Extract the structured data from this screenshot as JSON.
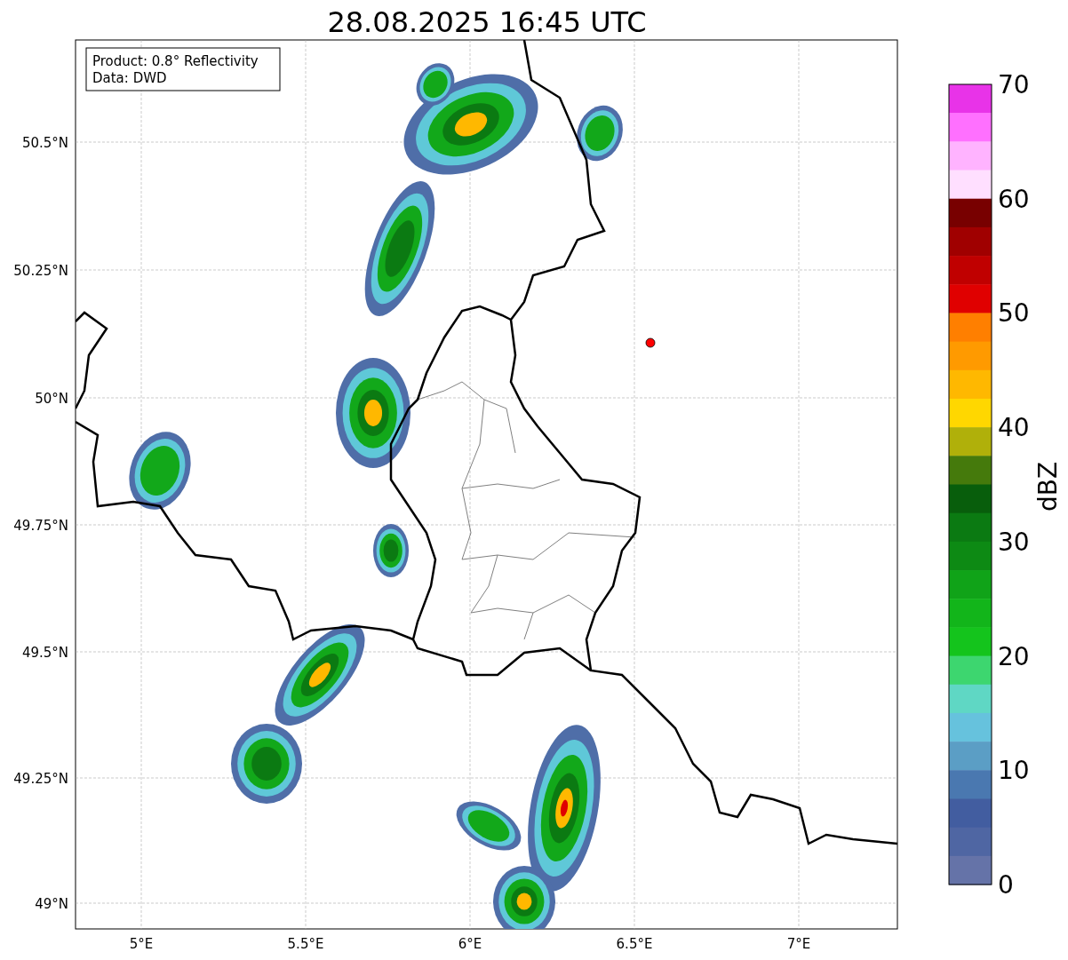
{
  "title": "28.08.2025 16:45 UTC",
  "info_box": [
    "Product: 0.8° Reflectivity",
    "Data: DWD"
  ],
  "y_ticks": [
    "50.5°N",
    "50.25°N",
    "50°N",
    "49.75°N",
    "49.5°N",
    "49.25°N",
    "49°N"
  ],
  "x_ticks": [
    "5°E",
    "5.5°E",
    "6°E",
    "6.5°E",
    "7°E"
  ],
  "colorbar": {
    "label": "dBZ",
    "ticks": [
      "70",
      "60",
      "50",
      "40",
      "30",
      "20",
      "10",
      "0"
    ],
    "bands": [
      {
        "color": "#e833e8"
      },
      {
        "color": "#ff70ff"
      },
      {
        "color": "#ffb3ff"
      },
      {
        "color": "#ffdfff"
      },
      {
        "color": "#780000"
      },
      {
        "color": "#a00000"
      },
      {
        "color": "#c00000"
      },
      {
        "color": "#e00000"
      },
      {
        "color": "#ff7f00"
      },
      {
        "color": "#ff9a00"
      },
      {
        "color": "#ffb800"
      },
      {
        "color": "#ffd700"
      },
      {
        "color": "#b0b00a"
      },
      {
        "color": "#457a0c"
      },
      {
        "color": "#085e0c"
      },
      {
        "color": "#0b7a12"
      },
      {
        "color": "#0d8a14"
      },
      {
        "color": "#10a318"
      },
      {
        "color": "#12b51a"
      },
      {
        "color": "#14c41c"
      },
      {
        "color": "#3dd66f"
      },
      {
        "color": "#5fd7c4"
      },
      {
        "color": "#66c2dd"
      },
      {
        "color": "#5b9ec5"
      },
      {
        "color": "#4a78b0"
      },
      {
        "color": "#425da0"
      },
      {
        "color": "#4f66a3"
      },
      {
        "color": "#6573a8"
      }
    ]
  }
}
